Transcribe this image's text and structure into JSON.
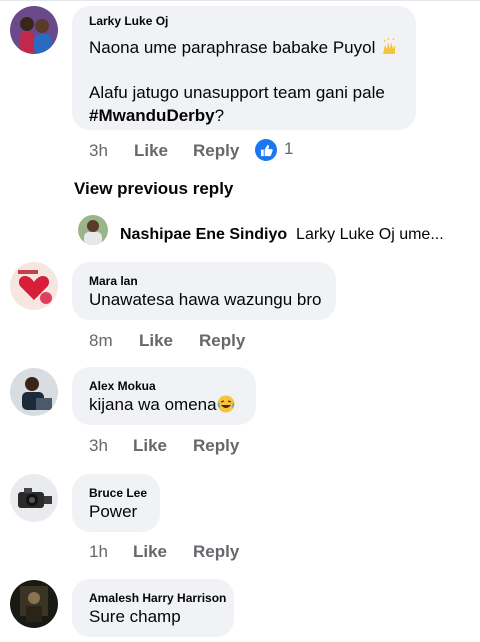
{
  "comments": [
    {
      "author": "Larky Luke Oj",
      "line1": "Naona ume paraphrase babake Puyol",
      "line1_emoji": "raised-hands-emoji",
      "line2": "Alafu jatugo unasupport team gani pale",
      "line3_bold": "#MwanduDerby",
      "line3_rest": "?",
      "time": "3h",
      "like_label": "Like",
      "reply_label": "Reply",
      "reaction_count": "1"
    },
    {
      "author": "Mara lan",
      "text": "Unawatesa hawa wazungu bro",
      "time": "8m",
      "like_label": "Like",
      "reply_label": "Reply"
    },
    {
      "author": "Alex Mokua",
      "text": "kijana wa omena",
      "text_emoji": "laughing-emoji",
      "time": "3h",
      "like_label": "Like",
      "reply_label": "Reply"
    },
    {
      "author": "Bruce Lee",
      "text": "Power",
      "time": "1h",
      "like_label": "Like",
      "reply_label": "Reply"
    },
    {
      "author": "Amalesh Harry Harrison",
      "text": "Sure champ"
    }
  ],
  "view_previous_reply": "View previous reply",
  "reply_preview": {
    "author": "Nashipae Ene Sindiyo",
    "snippet": "Larky Luke Oj ume..."
  },
  "colors": {
    "bubble": "#f0f2f5",
    "meta_text": "#65676b",
    "like_blue": "#1877f2"
  }
}
